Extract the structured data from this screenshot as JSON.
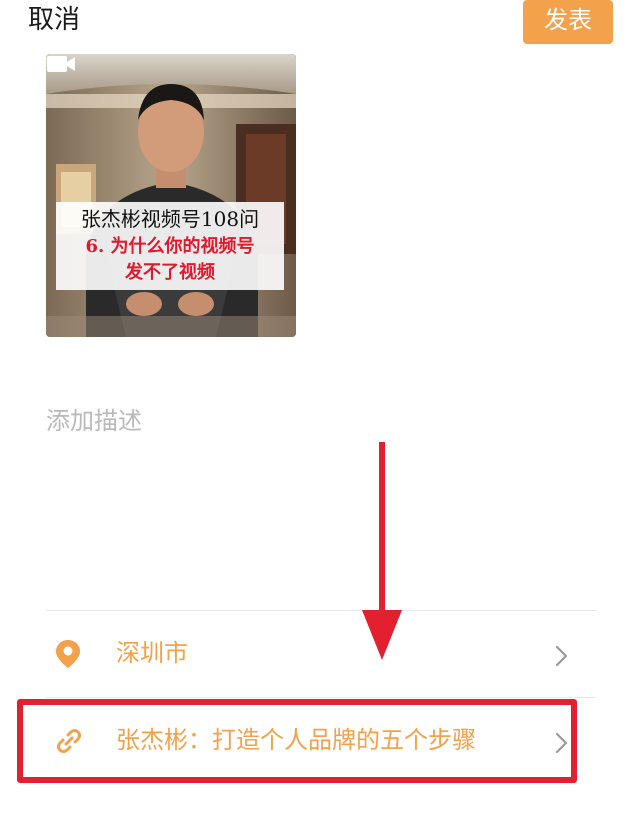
{
  "header": {
    "cancel_label": "取消",
    "publish_label": "发表"
  },
  "video": {
    "caption_line1": "张杰彬视频号108问",
    "caption_line2": "6. 为什么你的视频号",
    "caption_line3": "发不了视频",
    "icon": "video-camera-icon"
  },
  "description": {
    "placeholder": "添加描述"
  },
  "rows": {
    "location_label": "深圳市",
    "location_icon": "location-pin-icon",
    "link_label": "张杰彬：打造个人品牌的五个步骤",
    "link_icon": "link-icon"
  },
  "colors": {
    "accent": "#f3a14a",
    "annotation_red": "#e3202f"
  }
}
